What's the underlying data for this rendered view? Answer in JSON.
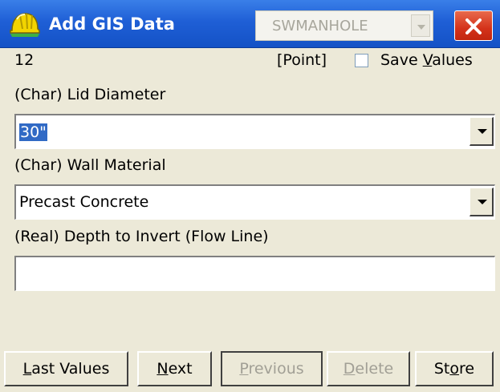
{
  "titlebar": {
    "title": "Add GIS Data",
    "feature_type": "SWMANHOLE"
  },
  "form": {
    "record_number": "12",
    "geometry_type": "[Point]",
    "save_values": {
      "pre": "Save ",
      "key": "V",
      "post": "alues",
      "checked": false
    },
    "fields": [
      {
        "label": "(Char) Lid Diameter",
        "value": "30\""
      },
      {
        "label": "(Char) Wall Material",
        "value": "Precast Concrete"
      },
      {
        "label": "(Real) Depth to Invert (Flow Line)",
        "value": ""
      }
    ]
  },
  "buttons": [
    {
      "pre": "",
      "key": "L",
      "post": "ast Values",
      "enabled": true
    },
    {
      "pre": "",
      "key": "N",
      "post": "ext",
      "enabled": true
    },
    {
      "pre": "",
      "key": "P",
      "post": "revious",
      "enabled": false
    },
    {
      "pre": "",
      "key": "D",
      "post": "elete",
      "enabled": false
    },
    {
      "pre": "St",
      "key": "o",
      "post": "re",
      "enabled": true
    }
  ],
  "colors": {
    "titlebar_blue": "#1f5fd6",
    "close_red": "#d4321a",
    "selection_blue": "#316ac5"
  }
}
